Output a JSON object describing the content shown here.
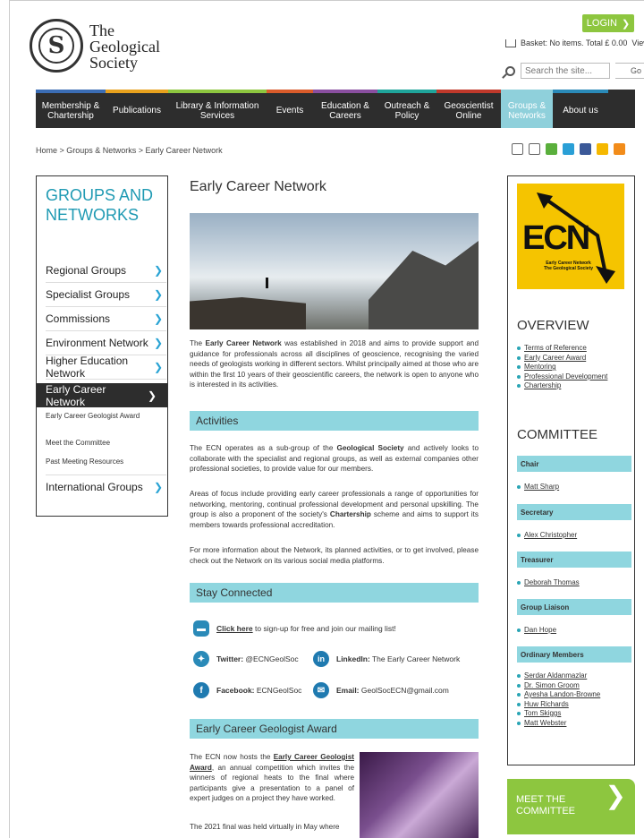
{
  "header": {
    "logo_lines": [
      "The",
      "Geological",
      "Society"
    ],
    "login_label": "LOGIN",
    "basket_text": "Basket: No items. Total £ 0.00",
    "basket_view": "View",
    "search_placeholder": "Search the site...",
    "search_go": "Go"
  },
  "nav": {
    "items": [
      {
        "label": "Membership &\nChartership",
        "color": "#3b6db5"
      },
      {
        "label": "Publications",
        "color": "#e8a11d"
      },
      {
        "label": "Library & Information\nServices",
        "color": "#8dc63f"
      },
      {
        "label": "Events",
        "color": "#d95b2a"
      },
      {
        "label": "Education &\nCareers",
        "color": "#8a4fa0"
      },
      {
        "label": "Outreach &\nPolicy",
        "color": "#1fa59b"
      },
      {
        "label": "Geoscientist\nOnline",
        "color": "#c0392b"
      },
      {
        "label": "Groups &\nNetworks",
        "color": "#8fd0db"
      },
      {
        "label": "About us",
        "color": "#2a8ab8"
      }
    ]
  },
  "breadcrumb": "Home > Groups & Networks > Early Career Network",
  "leftnav": {
    "title": "GROUPS AND NETWORKS",
    "items": [
      "Regional Groups",
      "Specialist Groups",
      "Commissions",
      "Environment Network",
      "Higher Education Network"
    ],
    "active": "Early Career Network",
    "sub_items": [
      "Early Career Geologist Award",
      "Meet the Committee",
      "Past Meeting Resources"
    ],
    "last_item": "International Groups"
  },
  "main": {
    "title": "Early Career Network",
    "intro_1": "The ",
    "intro_bold": "Early Career Network",
    "intro_2": " was established in 2018 and aims to provide support and guidance for professionals across all disciplines of geoscience, recognising the varied needs of geologists working in different sectors. Whilst principally aimed at those who are within the first 10 years of their geoscientific careers, the network is open to anyone who is interested in its activities.",
    "activities_heading": "Activities",
    "act_p1_a": "The ECN operates as a sub-group of the ",
    "act_p1_bold": "Geological Society",
    "act_p1_b": " and actively looks to collaborate with the specialist and regional groups, as well as external companies other professional societies, to provide value for our members.",
    "act_p2_a": "Areas of focus include providing early career professionals a range of opportunities for networking, mentoring, continual professional development and personal upskilling. The group is also a proponent of the society's ",
    "act_p2_bold": "Chartership",
    "act_p2_b": " scheme and aims to support its members towards professional accreditation.",
    "act_p3": "For more information about the Network, its planned activities, or to get involved, please check out the Network on its various social media platforms.",
    "stay_heading": "Stay Connected",
    "mailing_link": "Click here",
    "mailing_text": " to sign-up for free and join our mailing list!",
    "twitter_label": "Twitter:",
    "twitter_value": " @ECNGeolSoc",
    "linkedin_label": "LinkedIn:",
    "linkedin_value": " The Early Career Network",
    "facebook_label": "Facebook:",
    "facebook_value": " ECNGeolSoc",
    "email_label": "Email:",
    "email_value": " GeolSocECN@gmail.com",
    "award_heading": "Early Career Geologist Award",
    "award_p1_a": "The ECN now hosts the ",
    "award_p1_link": "Early Career Geologist Award",
    "award_p1_b": ", an annual competition which invites the winners of regional heats to the final where participants give a presentation to a panel of expert judges on a project they have worked.",
    "award_p2": "The 2021 final was held virtually in May where"
  },
  "right": {
    "logo_text": "ECN",
    "logo_sub": "Early Career Network\nThe Geological Society",
    "overview_heading": "OVERVIEW",
    "overview_items": [
      "Terms of Reference",
      "Early Career Award",
      "Mentoring",
      "Professional Development",
      "Chartership"
    ],
    "committee_heading": "COMMITTEE",
    "roles": [
      {
        "role": "Chair",
        "names": [
          "Matt Sharp"
        ]
      },
      {
        "role": "Secretary",
        "names": [
          "Alex Christopher"
        ]
      },
      {
        "role": "Treasurer",
        "names": [
          "Deborah Thomas"
        ]
      },
      {
        "role": "Group Liaison",
        "names": [
          "Dan Hope"
        ]
      },
      {
        "role": "Ordinary Members",
        "names": [
          "Serdar Aldanmazlar",
          "Dr. Simon Groom",
          "Ayesha Landon-Browne",
          "Huw Richards",
          "Tom Skiggs",
          "Matt Webster"
        ]
      }
    ],
    "meet_label": "MEET THE\nCOMMITTEE"
  }
}
